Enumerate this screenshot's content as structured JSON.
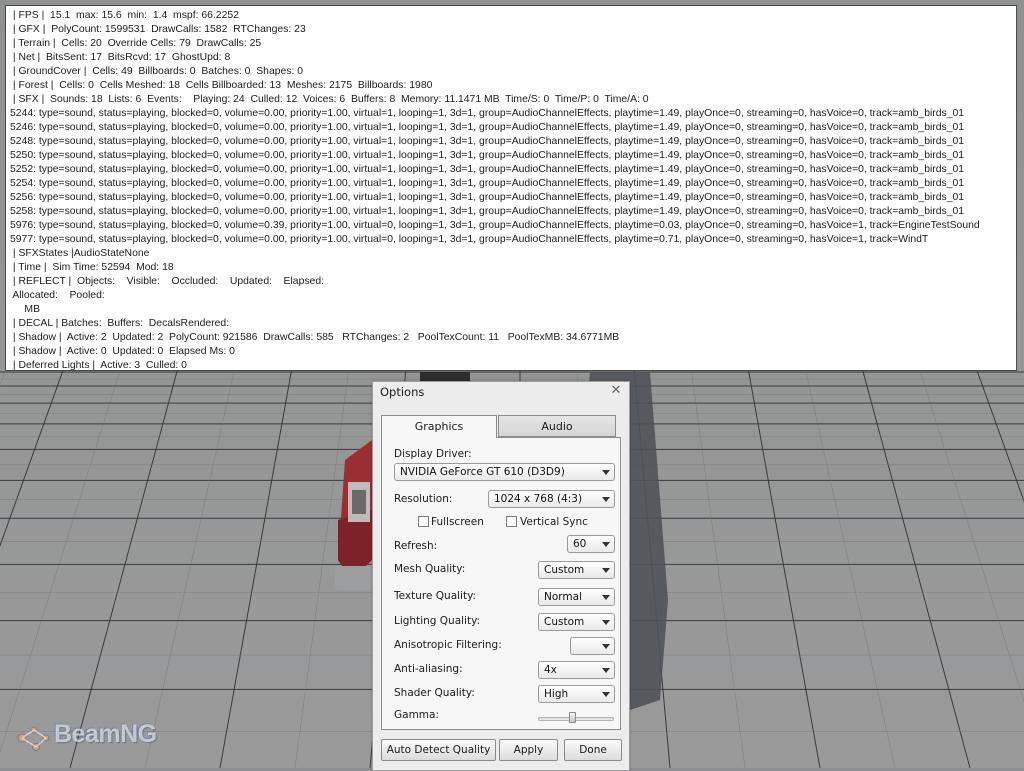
{
  "debug_console": {
    "lines": [
      " | FPS |  15.1  max: 15.6  min:  1.4  mspf: 66.2252",
      " | GFX |  PolyCount: 1599531  DrawCalls: 1582  RTChanges: 23",
      " | Terrain |  Cells: 20  Override Cells: 79  DrawCalls: 25",
      " | Net |  BitsSent: 17  BitsRcvd: 17  GhostUpd: 8",
      " | GroundCover |  Cells: 49  Billboards: 0  Batches: 0  Shapes: 0",
      " | Forest |  Cells: 0  Cells Meshed: 18  Cells Billboarded: 13  Meshes: 2175  Billboards: 1980",
      " | SFX |  Sounds: 18  Lists: 6  Events:    Playing: 24  Culled: 12  Voices: 6  Buffers: 8  Memory: 11.1471 MB  Time/S: 0  Time/P: 0  Time/A: 0",
      "5244: type=sound, status=playing, blocked=0, volume=0.00, priority=1.00, virtual=1, looping=1, 3d=1, group=AudioChannelEffects, playtime=1.49, playOnce=0, streaming=0, hasVoice=0, track=amb_birds_01",
      "5246: type=sound, status=playing, blocked=0, volume=0.00, priority=1.00, virtual=1, looping=1, 3d=1, group=AudioChannelEffects, playtime=1.49, playOnce=0, streaming=0, hasVoice=0, track=amb_birds_01",
      "5248: type=sound, status=playing, blocked=0, volume=0.00, priority=1.00, virtual=1, looping=1, 3d=1, group=AudioChannelEffects, playtime=1.49, playOnce=0, streaming=0, hasVoice=0, track=amb_birds_01",
      "5250: type=sound, status=playing, blocked=0, volume=0.00, priority=1.00, virtual=1, looping=1, 3d=1, group=AudioChannelEffects, playtime=1.49, playOnce=0, streaming=0, hasVoice=0, track=amb_birds_01",
      "5252: type=sound, status=playing, blocked=0, volume=0.00, priority=1.00, virtual=1, looping=1, 3d=1, group=AudioChannelEffects, playtime=1.49, playOnce=0, streaming=0, hasVoice=0, track=amb_birds_01",
      "5254: type=sound, status=playing, blocked=0, volume=0.00, priority=1.00, virtual=1, looping=1, 3d=1, group=AudioChannelEffects, playtime=1.49, playOnce=0, streaming=0, hasVoice=0, track=amb_birds_01",
      "5256: type=sound, status=playing, blocked=0, volume=0.00, priority=1.00, virtual=1, looping=1, 3d=1, group=AudioChannelEffects, playtime=1.49, playOnce=0, streaming=0, hasVoice=0, track=amb_birds_01",
      "5258: type=sound, status=playing, blocked=0, volume=0.00, priority=1.00, virtual=1, looping=1, 3d=1, group=AudioChannelEffects, playtime=1.49, playOnce=0, streaming=0, hasVoice=0, track=amb_birds_01",
      "5976: type=sound, status=playing, blocked=0, volume=0.39, priority=1.00, virtual=0, looping=1, 3d=1, group=AudioChannelEffects, playtime=0.03, playOnce=0, streaming=0, hasVoice=1, track=EngineTestSound",
      "5977: type=sound, status=playing, blocked=0, volume=0.00, priority=1.00, virtual=0, looping=1, 3d=1, group=AudioChannelEffects, playtime=0.71, playOnce=0, streaming=0, hasVoice=1, track=WindT",
      " | SFXStates |AudioStateNone",
      " | Time |  Sim Time: 52594  Mod: 18",
      " | REFLECT |  Objects:    Visible:    Occluded:    Updated:    Elapsed:",
      " Allocated:    Pooled:",
      "     MB",
      " | DECAL | Batches:  Buffers:  DecalsRendered:",
      " | Shadow |  Active: 2  Updated: 2  PolyCount: 921586  DrawCalls: 585   RTChanges: 2   PoolTexCount: 11   PoolTexMB: 34.6771MB",
      " | Shadow |  Active: 0  Updated: 0  Elapsed Ms: 0",
      " | Deferred Lights |  Active: 3  Culled: 0"
    ]
  },
  "logo": {
    "text": "BeamNG"
  },
  "options_dialog": {
    "title": "Options",
    "close_icon": "close-icon",
    "tabs": [
      {
        "label": "Graphics",
        "selected": true
      },
      {
        "label": "Audio",
        "selected": false
      }
    ],
    "graphics": {
      "display_driver": {
        "label": "Display Driver:",
        "value": "NVIDIA GeForce GT 610 (D3D9)"
      },
      "resolution": {
        "label": "Resolution:",
        "value": "1024 x 768  (4:3)"
      },
      "fullscreen": {
        "label": "Fullscreen",
        "checked": false
      },
      "vertical_sync": {
        "label": "Vertical Sync",
        "checked": false
      },
      "refresh": {
        "label": "Refresh:",
        "value": "60"
      },
      "mesh_quality": {
        "label": "Mesh Quality:",
        "value": "Custom"
      },
      "texture_quality": {
        "label": "Texture Quality:",
        "value": "Normal"
      },
      "lighting_quality": {
        "label": "Lighting Quality:",
        "value": "Custom"
      },
      "anisotropic_filtering": {
        "label": "Anisotropic Filtering:",
        "value": ""
      },
      "anti_aliasing": {
        "label": "Anti-aliasing:",
        "value": "4x"
      },
      "shader_quality": {
        "label": "Shader Quality:",
        "value": "High"
      },
      "gamma": {
        "label": "Gamma:",
        "value": 0.45
      }
    },
    "buttons": {
      "auto_detect": "Auto Detect Quality",
      "apply": "Apply",
      "done": "Done"
    }
  },
  "colors": {
    "console_bg": "#ffffff",
    "dialog_bg": "#ececec",
    "ground": "#8e8f90",
    "truck": "#9b2e33"
  }
}
